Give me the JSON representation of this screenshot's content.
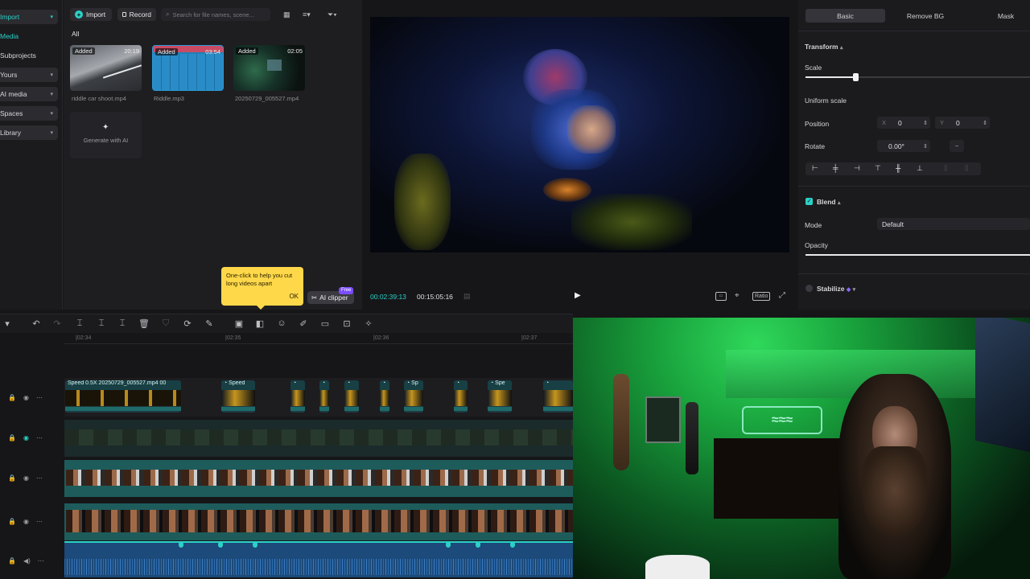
{
  "nav": {
    "items": [
      {
        "label": "Import",
        "teal": true,
        "selected": true,
        "chevron": true
      },
      {
        "label": "Media",
        "teal": true,
        "selected": false,
        "chevron": false
      },
      {
        "label": "Subprojects",
        "teal": false,
        "selected": false,
        "chevron": false
      },
      {
        "label": "Yours",
        "teal": false,
        "selected": true,
        "chevron": true
      },
      {
        "label": "AI media",
        "teal": false,
        "selected": true,
        "chevron": true
      },
      {
        "label": "Spaces",
        "teal": false,
        "selected": true,
        "chevron": true
      },
      {
        "label": "Library",
        "teal": false,
        "selected": true,
        "chevron": true
      }
    ]
  },
  "media": {
    "import_label": "Import",
    "record_label": "Record",
    "search_placeholder": "Search for file names, scene...",
    "filter_all": "All",
    "items": [
      {
        "badge": "Added",
        "duration": "20:19",
        "name": "riddle car shoot.mp4"
      },
      {
        "badge": "Added",
        "duration": "03:54",
        "name": "Riddle.mp3"
      },
      {
        "badge": "Added",
        "duration": "02:05",
        "name": "20250729_005527.mp4"
      }
    ],
    "generate_label": "Generate with AI",
    "tooltip_text": "One-click to help you cut long videos apart",
    "tooltip_ok": "OK",
    "ai_clipper_label": "AI clipper",
    "ai_clipper_badge": "Free"
  },
  "preview": {
    "current_time": "00:02:39:13",
    "total_time": "00:15:05:16",
    "ratio_label": "Ratio"
  },
  "props": {
    "tabs": [
      "Basic",
      "Remove BG",
      "Mask"
    ],
    "transform_label": "Transform",
    "scale_label": "Scale",
    "scale_level": 0.4,
    "uniform_scale_label": "Uniform scale",
    "position_label": "Position",
    "pos_x_label": "X",
    "pos_x": "0",
    "pos_y_label": "Y",
    "pos_y": "0",
    "rotate_label": "Rotate",
    "rotate_value": "0.00°",
    "blend_label": "Blend",
    "mode_label": "Mode",
    "mode_value": "Default",
    "opacity_label": "Opacity",
    "opacity_level": 1.0,
    "stabilize_label": "Stabilize"
  },
  "timeline": {
    "ruler_labels": [
      "|02:34",
      "|02:35",
      "|02:36",
      "|02:37"
    ],
    "clip_labels": {
      "first": "Speed 0.5X",
      "second": "20250729_005527.mp4",
      "third": "00",
      "speed": "Speed",
      "sp": "Sp",
      "spe": "Spe"
    }
  },
  "colors": {
    "accent": "#2bd1c7",
    "tooltip": "#ffd84a",
    "teal_track": "#1e5c5c"
  }
}
